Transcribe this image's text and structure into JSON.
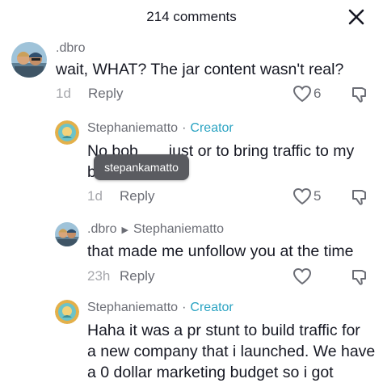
{
  "header": {
    "title": "214 comments",
    "close_icon": "close-icon"
  },
  "comments": [
    {
      "author": ".dbro",
      "text": "wait, WHAT? The jar content wasn't real?",
      "time": "1d",
      "reply_label": "Reply",
      "likes": "6"
    },
    {
      "author": "Stephaniematto",
      "badge": "Creator",
      "text_line1": "No bob       just or to bring traffic to my",
      "text_line2": "b",
      "time": "1d",
      "reply_label": "Reply",
      "likes": "5"
    },
    {
      "author": ".dbro",
      "reply_to": "Stephaniematto",
      "text": "that made me unfollow you at the time",
      "time": "23h",
      "reply_label": "Reply",
      "likes": ""
    },
    {
      "author": "Stephaniematto",
      "badge": "Creator",
      "text_line1": "Haha it was a pr stunt to build traffic for",
      "text_line2": "a new company that i launched. We have",
      "text_line3": "a 0 dollar marketing budget so i got"
    }
  ],
  "tooltip": {
    "text": "stepankamatto"
  },
  "colors": {
    "creator": "#2aa3c2",
    "text": "#161823",
    "muted": "#8a8b91"
  }
}
